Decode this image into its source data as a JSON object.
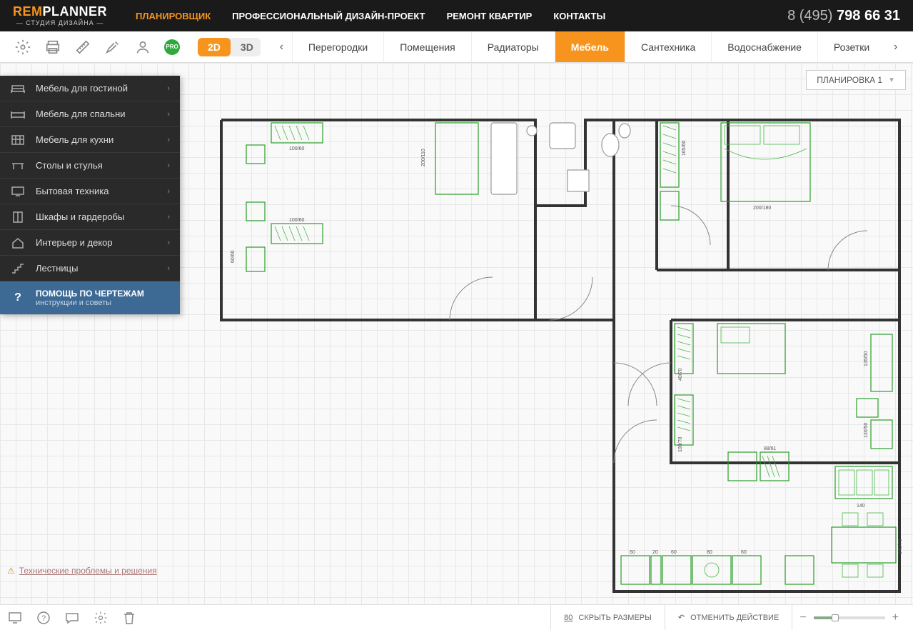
{
  "logo": {
    "rem": "REM",
    "planner": "PLANNER",
    "sub": "— СТУДИЯ ДИЗАЙНА —"
  },
  "nav": {
    "items": [
      {
        "label": "ПЛАНИРОВЩИК",
        "active": true
      },
      {
        "label": "ПРОФЕССИОНАЛЬНЫЙ ДИЗАЙН-ПРОЕКТ"
      },
      {
        "label": "РЕМОНТ КВАРТИР"
      },
      {
        "label": "КОНТАКТЫ"
      }
    ]
  },
  "phone": {
    "prefix": "8 (495) ",
    "number": "798 66 31"
  },
  "view": {
    "d2": "2D",
    "d3": "3D"
  },
  "pro": "PRO",
  "tabs": [
    {
      "label": "Перегородки"
    },
    {
      "label": "Помещения"
    },
    {
      "label": "Радиаторы"
    },
    {
      "label": "Мебель",
      "active": true
    },
    {
      "label": "Сантехника"
    },
    {
      "label": "Водоснабжение"
    },
    {
      "label": "Розетки"
    }
  ],
  "plan_dropdown": "ПЛАНИРОВКА 1",
  "sidebar": {
    "items": [
      {
        "label": "Мебель для гостиной"
      },
      {
        "label": "Мебель для спальни"
      },
      {
        "label": "Мебель для кухни"
      },
      {
        "label": "Столы и стулья"
      },
      {
        "label": "Бытовая техника"
      },
      {
        "label": "Шкафы и гардеробы"
      },
      {
        "label": "Интерьер и декор"
      },
      {
        "label": "Лестницы"
      }
    ],
    "help": {
      "title": "ПОМОЩЬ ПО ЧЕРТЕЖАМ",
      "sub": "инструкции и советы"
    }
  },
  "dims": {
    "d1": "100/60",
    "d2": "200/110",
    "d3": "100/60",
    "d4": "60/60",
    "d5": "165/60",
    "d6": "200/180",
    "d7": "40/70",
    "d8": "100/70",
    "d9": "135/50",
    "d10": "130/50",
    "d11": "88/61",
    "d12": "140",
    "d13": "60",
    "d14": "20",
    "d15": "60",
    "d16": "80",
    "d17": "60",
    "d18": "140/76"
  },
  "tech_link": "Технические проблемы и решения",
  "bottom": {
    "hide_dims": "СКРЫТЬ РАЗМЕРЫ",
    "undo": "ОТМЕНИТЬ ДЕЙСТВИЕ"
  }
}
